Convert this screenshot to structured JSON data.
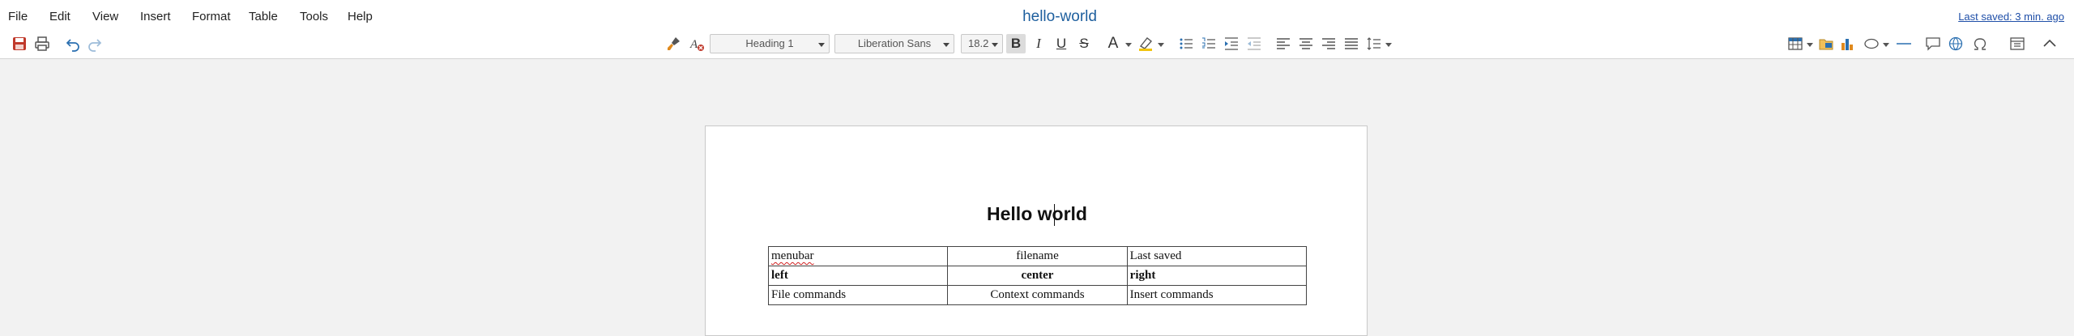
{
  "menubar": {
    "items": [
      "File",
      "Edit",
      "View",
      "Insert",
      "Format",
      "Table",
      "Tools",
      "Help"
    ],
    "doc_title": "hello-world",
    "last_saved": "Last saved: 3 min. ago"
  },
  "toolbar": {
    "paragraph_style": "Heading 1",
    "font_name": "Liberation Sans",
    "font_size": "18.2",
    "bold_label": "B",
    "italic_label": "I",
    "underline_label": "U",
    "strike_label": "S",
    "font_color_label": "A"
  },
  "document": {
    "heading": "Hello world",
    "table": {
      "rows": [
        [
          "menubar",
          "filename",
          "Last saved"
        ],
        [
          "left",
          "center",
          "right"
        ],
        [
          "File commands",
          "Context commands",
          "Insert commands"
        ]
      ]
    }
  },
  "colors": {
    "title": "#1e5f9e",
    "link": "#1f4fa8",
    "save_icon": "#c0392b",
    "chart_icon": "#e08a1e",
    "accent_icon": "#2a6fb0"
  }
}
